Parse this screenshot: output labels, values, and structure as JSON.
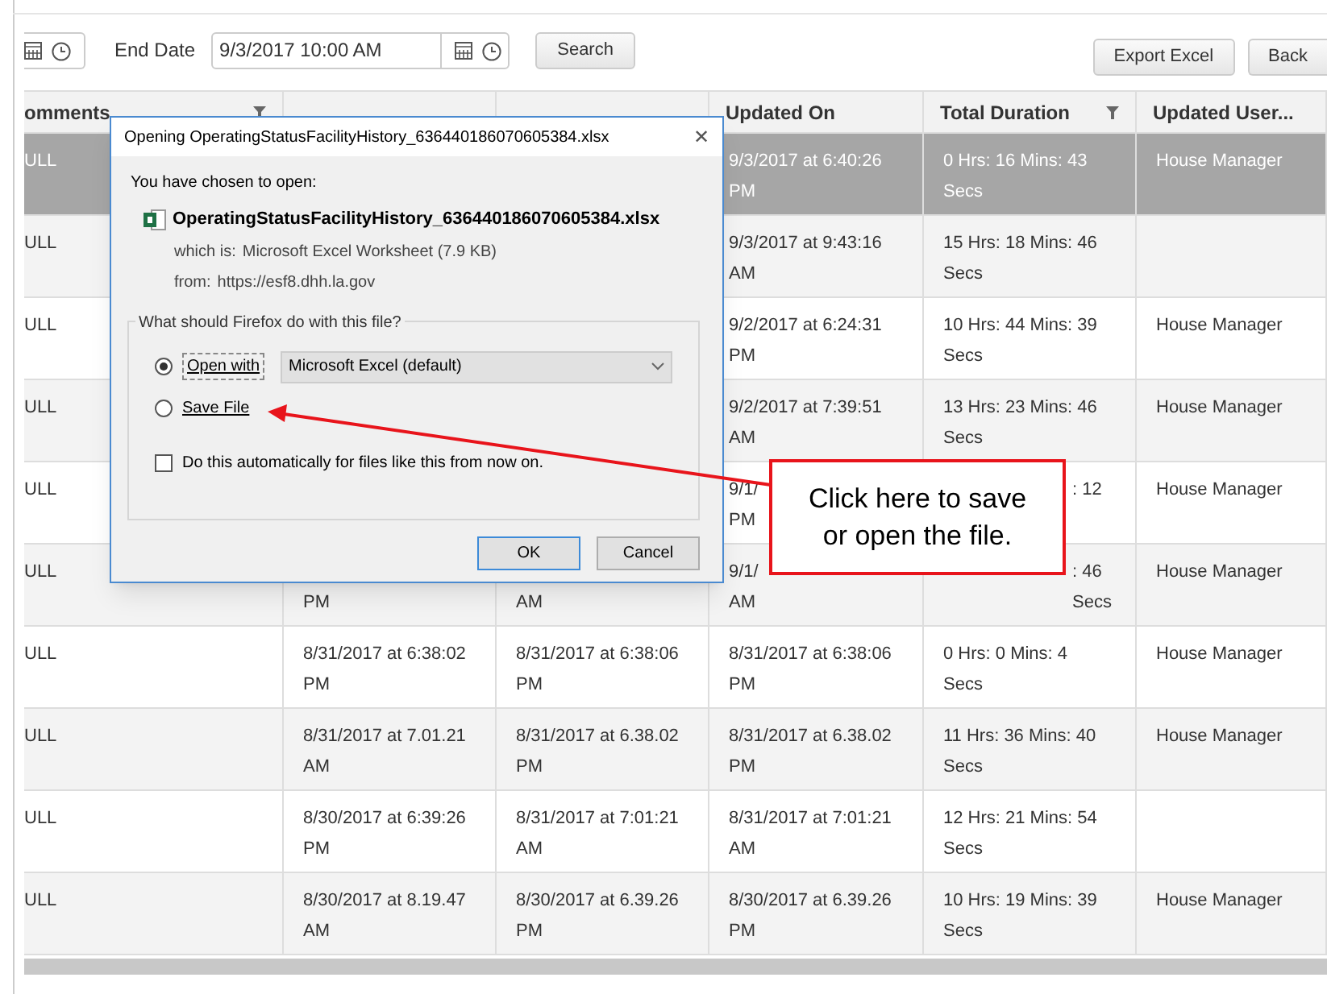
{
  "toolbar": {
    "end_date_label": "End Date",
    "end_date_value": "9/3/2017 10:00 AM",
    "search_button": "Search",
    "export_button": "Export Excel",
    "back_button": "Back"
  },
  "table": {
    "columns": [
      {
        "label": "omments",
        "filter": true
      },
      {
        "filter": false
      },
      {
        "filter": false
      },
      {
        "label": "Updated On",
        "filter": false
      },
      {
        "label": "Total Duration",
        "filter": true
      },
      {
        "label": "Updated User...",
        "filter": false
      }
    ],
    "rows": [
      {
        "selected": true,
        "comments": [
          "ULL"
        ],
        "updated_on": [
          "9/3/2017 at 6:40:26",
          "PM"
        ],
        "total_duration": [
          "0 Hrs: 16 Mins: 43",
          "Secs"
        ],
        "updated_user": [
          "House Manager"
        ]
      },
      {
        "selected": false,
        "comments": [
          "ULL"
        ],
        "updated_on": [
          "9/3/2017 at 9:43:16",
          "AM"
        ],
        "total_duration": [
          "15 Hrs: 18 Mins: 46",
          "Secs"
        ]
      },
      {
        "selected": false,
        "comments": [
          "ULL"
        ],
        "updated_on": [
          "9/2/2017 at 6:24:31",
          "PM"
        ],
        "total_duration": [
          "10 Hrs: 44 Mins: 39",
          "Secs"
        ],
        "updated_user": [
          "House Manager"
        ]
      },
      {
        "selected": false,
        "comments": [
          "ULL"
        ],
        "updated_on": [
          "9/2/2017 at 7:39:51",
          "AM"
        ],
        "total_duration": [
          "13 Hrs: 23 Mins: 46",
          "Secs"
        ],
        "updated_user": [
          "House Manager"
        ]
      },
      {
        "selected": false,
        "comments": [
          "ULL"
        ],
        "updated_on": [
          "9/1/",
          "PM"
        ],
        "total_duration": [
          ": 12"
        ],
        "duration_clipped": true,
        "updated_user": [
          "House Manager"
        ]
      },
      {
        "selected": false,
        "comments": [
          "ULL"
        ],
        "start_date": [
          "PM"
        ],
        "end_date": [
          "AM"
        ],
        "updated_on": [
          "9/1/",
          "AM"
        ],
        "total_duration": [
          ": 46",
          "Secs"
        ],
        "duration_clipped": true,
        "updated_user": [
          "House Manager"
        ]
      },
      {
        "selected": false,
        "comments": [
          "ULL"
        ],
        "start_date": [
          "8/31/2017 at 6:38:02",
          "PM"
        ],
        "end_date": [
          "8/31/2017 at 6:38:06",
          "PM"
        ],
        "updated_on": [
          "8/31/2017 at 6:38:06",
          "PM"
        ],
        "total_duration": [
          "0 Hrs: 0 Mins: 4",
          "Secs"
        ],
        "updated_user": [
          "House Manager"
        ]
      },
      {
        "selected": false,
        "comments": [
          "ULL"
        ],
        "start_date": [
          "8/31/2017 at 7.01.21",
          "AM"
        ],
        "end_date": [
          "8/31/2017 at 6.38.02",
          "PM"
        ],
        "updated_on": [
          "8/31/2017 at 6.38.02",
          "PM"
        ],
        "total_duration": [
          "11 Hrs: 36 Mins: 40",
          "Secs"
        ],
        "updated_user": [
          "House Manager"
        ]
      },
      {
        "selected": false,
        "comments": [
          "ULL"
        ],
        "start_date": [
          "8/30/2017 at 6:39:26",
          "PM"
        ],
        "end_date": [
          "8/31/2017 at 7:01:21",
          "AM"
        ],
        "updated_on": [
          "8/31/2017 at 7:01:21",
          "AM"
        ],
        "total_duration": [
          "12 Hrs: 21 Mins: 54",
          "Secs"
        ]
      },
      {
        "selected": false,
        "comments": [
          "ULL"
        ],
        "start_date": [
          "8/30/2017 at 8.19.47",
          "AM"
        ],
        "end_date": [
          "8/30/2017 at 6.39.26",
          "PM"
        ],
        "updated_on": [
          "8/30/2017 at 6.39.26",
          "PM"
        ],
        "total_duration": [
          "10 Hrs: 19 Mins: 39",
          "Secs"
        ],
        "updated_user": [
          "House Manager"
        ]
      }
    ]
  },
  "dialog": {
    "title": "Opening OperatingStatusFacilityHistory_636440186070605384.xlsx",
    "close": "✕",
    "intro": "You have chosen to open:",
    "file_name": "OperatingStatusFacilityHistory_636440186070605384.xlsx",
    "which_is_label": "which is:",
    "which_is": "Microsoft Excel Worksheet (7.9 KB)",
    "from_label": "from:",
    "from": "https://esf8.dhh.la.gov",
    "group_label": "What should Firefox do with this file?",
    "options": [
      {
        "label": "Open with",
        "selected": true
      },
      {
        "label": "Save File",
        "selected": false
      }
    ],
    "app": "Microsoft Excel (default)",
    "auto": {
      "label": "Do this automatically for files like this from now on.",
      "checked": false
    },
    "buttons": [
      {
        "label": "OK",
        "default": true
      },
      {
        "label": "Cancel",
        "default": false
      }
    ]
  },
  "callout": {
    "text": "Click here to save or open the file."
  }
}
